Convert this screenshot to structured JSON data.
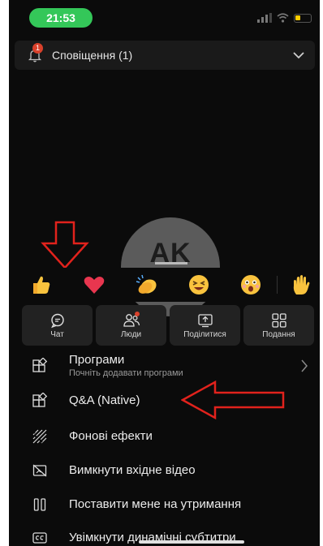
{
  "status_bar": {
    "time": "21:53",
    "battery_color": "#ffcc00",
    "time_pill_color": "#34c759"
  },
  "notification": {
    "label": "Сповіщення (1)",
    "badge_count": "1"
  },
  "avatar": {
    "initials": "AK"
  },
  "reactions": [
    "thumbs-up",
    "heart",
    "clapping-hands",
    "laughing-face",
    "surprised-face",
    "raised-hand"
  ],
  "toolbar": [
    {
      "label": "Чат",
      "icon": "chat-icon"
    },
    {
      "label": "Люди",
      "icon": "people-icon"
    },
    {
      "label": "Поділитися",
      "icon": "share-icon"
    },
    {
      "label": "Подання",
      "icon": "view-icon"
    }
  ],
  "menu": {
    "apps": {
      "label": "Програми",
      "sub": "Почніть додавати програми"
    },
    "qa": {
      "label": "Q&A (Native)"
    },
    "background": {
      "label": "Фонові ефекти"
    },
    "video_off": {
      "label": "Вимкнути вхідне відео"
    },
    "hold": {
      "label": "Поставити мене на утримання"
    },
    "captions": {
      "label": "Увімкнути динамічні субтитри"
    }
  },
  "colors": {
    "annotation_red": "#e1221c",
    "accent_red": "#d9412b",
    "background": "#0b0b0b"
  }
}
